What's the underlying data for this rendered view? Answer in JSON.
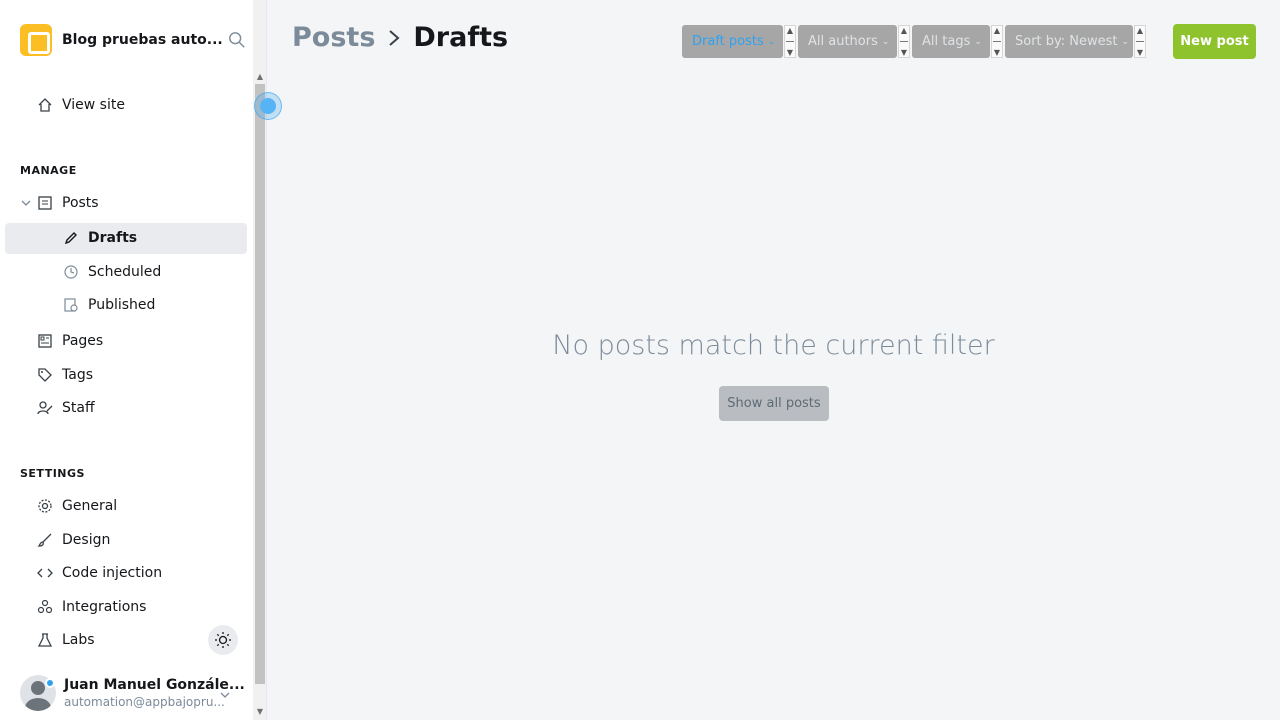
{
  "brand": {
    "title": "Blog pruebas auto..."
  },
  "sidebar": {
    "view_site": "View site",
    "manage_heading": "MANAGE",
    "posts": "Posts",
    "drafts": "Drafts",
    "scheduled": "Scheduled",
    "published": "Published",
    "pages": "Pages",
    "tags": "Tags",
    "staff": "Staff",
    "settings_heading": "SETTINGS",
    "general": "General",
    "design": "Design",
    "code_injection": "Code injection",
    "integrations": "Integrations",
    "labs": "Labs"
  },
  "user": {
    "name": "Juan Manuel Gonzále...",
    "email": "automation@appbajopru..."
  },
  "header": {
    "breadcrumb_parent": "Posts",
    "breadcrumb_current": "Drafts"
  },
  "filters": {
    "type": "Draft posts",
    "author": "All authors",
    "tag": "All tags",
    "sort": "Sort by: Newest"
  },
  "actions": {
    "new_post": "New post"
  },
  "empty_state": {
    "message": "No posts match the current filter",
    "button": "Show all posts"
  },
  "colors": {
    "accent": "#30a1f0",
    "primary_button": "#8fc32e",
    "muted_text": "#7c8b9a"
  }
}
